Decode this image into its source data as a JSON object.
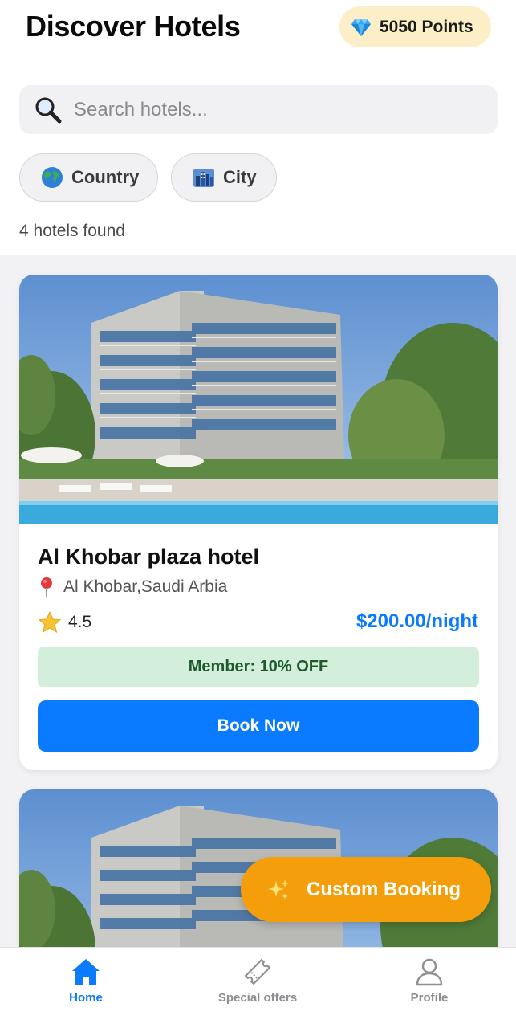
{
  "header": {
    "title": "Discover Hotels",
    "points_label": "5050 Points",
    "points_icon": "gem-icon"
  },
  "search": {
    "placeholder": "Search hotels...",
    "value": "",
    "icon": "magnifier-icon"
  },
  "filters": [
    {
      "label": "Country",
      "icon": "globe-icon"
    },
    {
      "label": "City",
      "icon": "cityscape-icon"
    }
  ],
  "results_count": "4 hotels found",
  "hotels": [
    {
      "name": "Al Khobar plaza hotel",
      "location": "Al Khobar,Saudi Arbia",
      "rating": "4.5",
      "price": "$200.00/night",
      "member_discount": "Member: 10% OFF",
      "book_label": "Book Now"
    }
  ],
  "fab": {
    "label": "Custom Booking",
    "icon": "sparkles-icon"
  },
  "tabbar": {
    "items": [
      {
        "label": "Home",
        "icon": "home-icon",
        "active": true
      },
      {
        "label": "Special offers",
        "icon": "ticket-icon",
        "active": false
      },
      {
        "label": "Profile",
        "icon": "user-icon",
        "active": false
      }
    ]
  },
  "colors": {
    "accent": "#0a7aff",
    "points_bg": "#fcefc7",
    "member_bg": "#d3eedb",
    "member_text": "#1f5a2c",
    "fab": "#f59e0b",
    "inactive_tab": "#8e8e93"
  }
}
